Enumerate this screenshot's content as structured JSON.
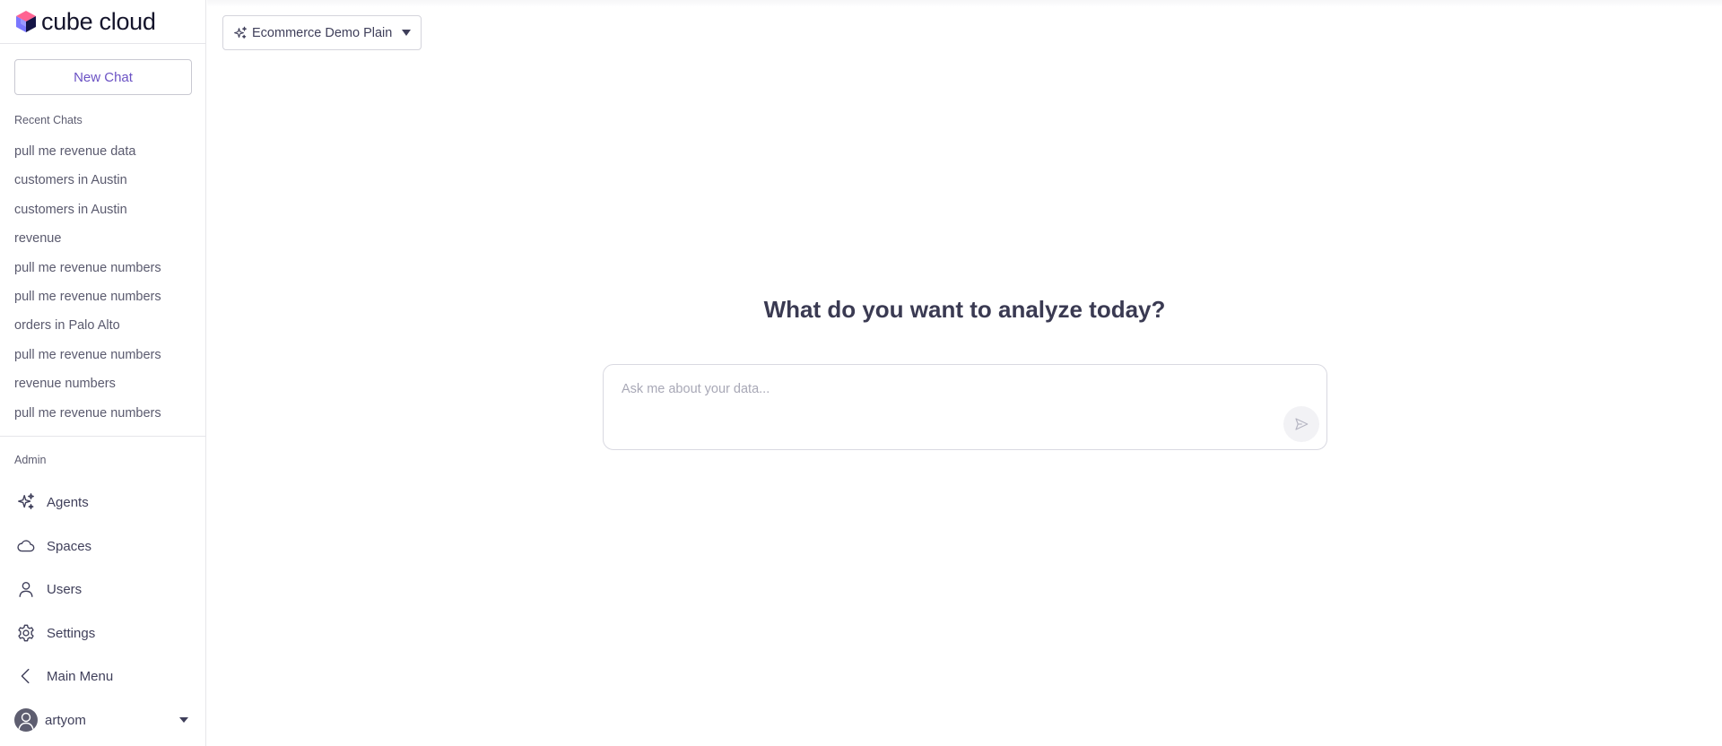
{
  "brand": {
    "name": "cube cloud"
  },
  "sidebar": {
    "new_chat_label": "New Chat",
    "recent_title": "Recent Chats",
    "recent": [
      "pull me revenue data",
      "customers in Austin",
      "customers in Austin",
      "revenue",
      "pull me revenue numbers",
      "pull me revenue numbers",
      "orders in Palo Alto",
      "pull me revenue numbers",
      "revenue numbers",
      "pull me revenue numbers"
    ],
    "admin_title": "Admin",
    "admin": [
      {
        "label": "Agents",
        "icon": "sparkles-icon"
      },
      {
        "label": "Spaces",
        "icon": "cloud-icon"
      },
      {
        "label": "Users",
        "icon": "user-icon"
      },
      {
        "label": "Settings",
        "icon": "gear-icon"
      },
      {
        "label": "Main Menu",
        "icon": "chevron-left-icon"
      }
    ],
    "user": {
      "name": "artyom"
    }
  },
  "main": {
    "agent_select": {
      "value": "Ecommerce Demo Plain"
    },
    "headline": "What do you want to analyze today?",
    "prompt": {
      "placeholder": "Ask me about your data...",
      "value": ""
    }
  },
  "colors": {
    "accent": "#6b52c4",
    "text": "#3f3f5a",
    "border": "#d9d9e1"
  }
}
